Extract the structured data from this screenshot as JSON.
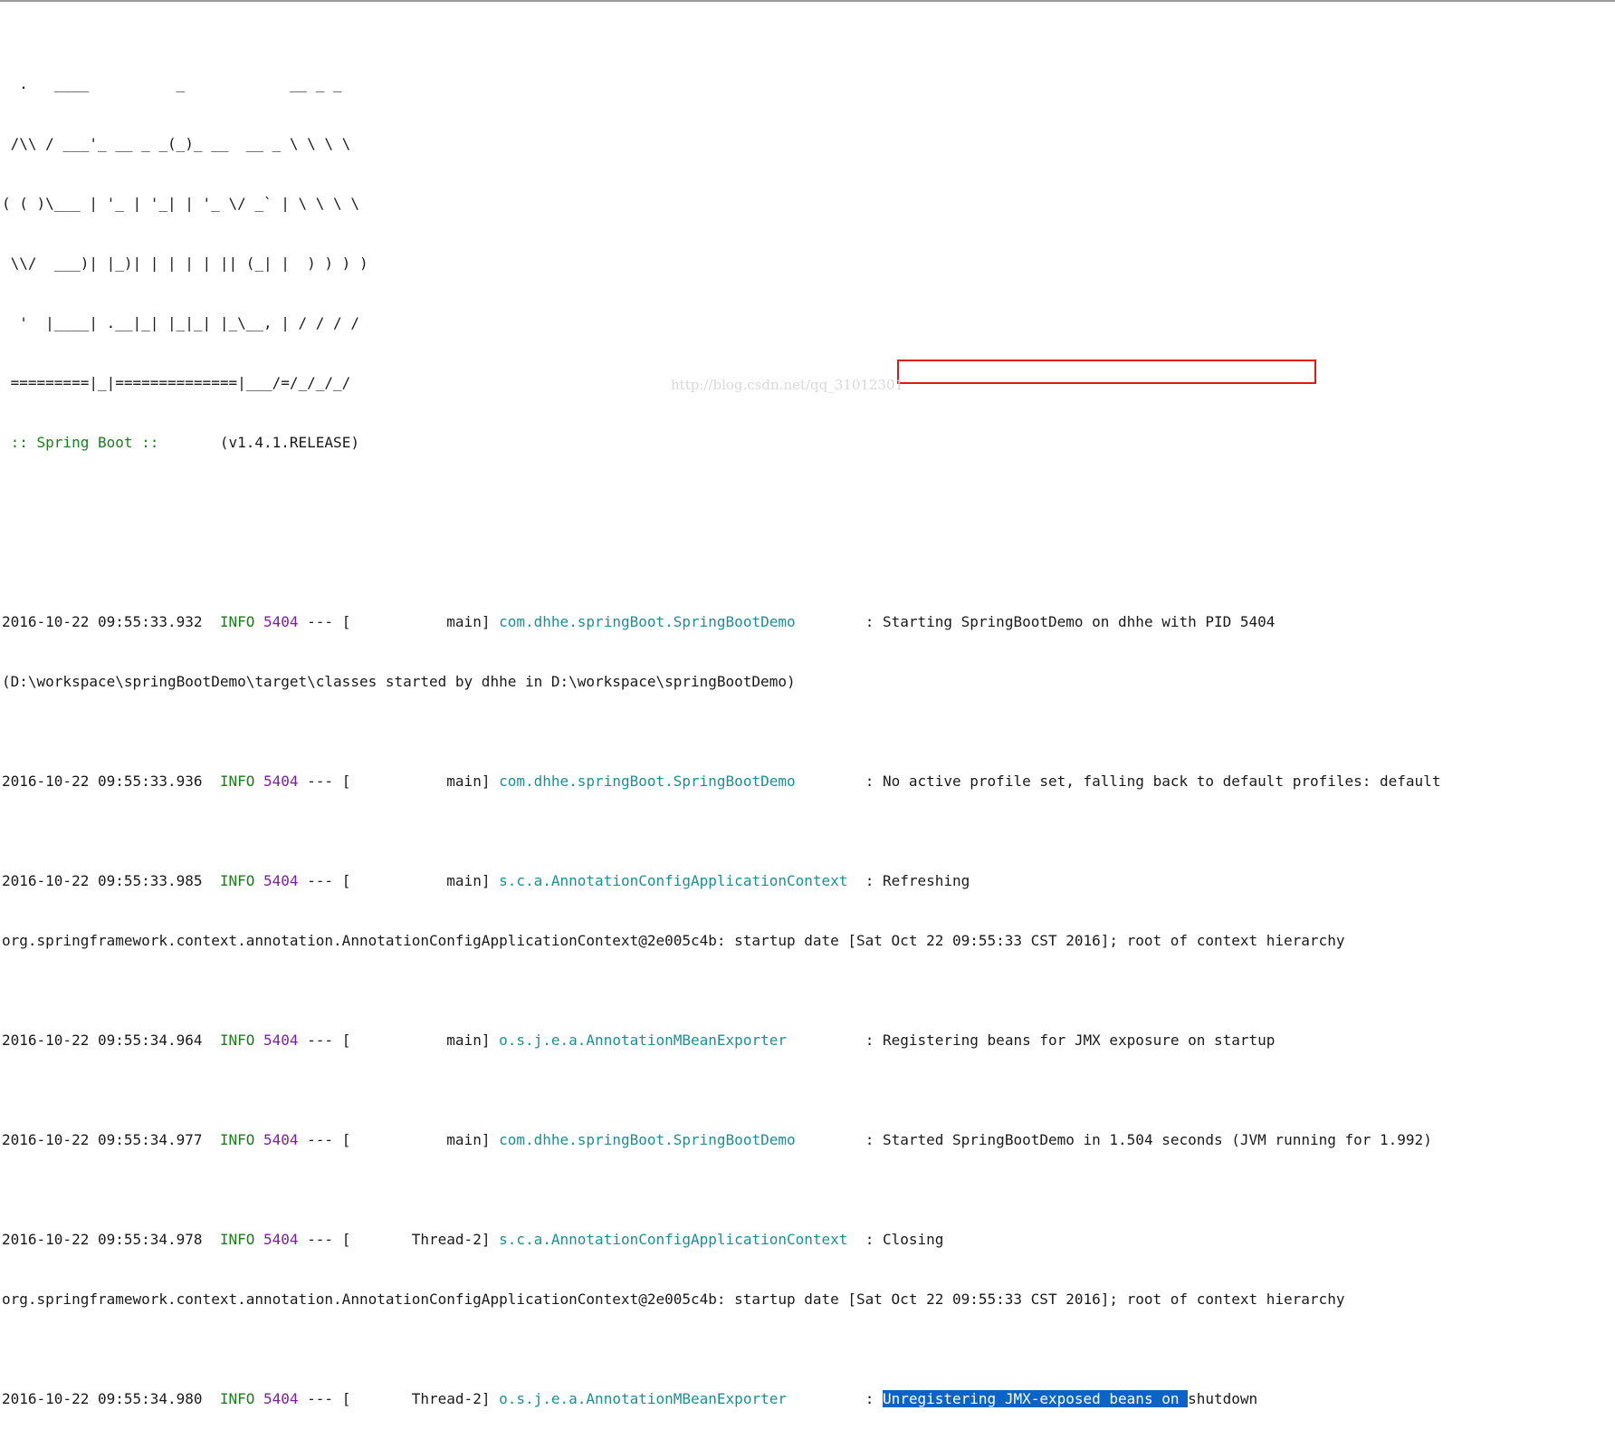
{
  "banner": {
    "lines": [
      "  .   ____          _            __ _ _",
      " /\\\\ / ___'_ __ _ _(_)_ __  __ _ \\ \\ \\ \\",
      "( ( )\\___ | '_ | '_| | '_ \\/ _` | \\ \\ \\ \\",
      " \\\\/  ___)| |_)| | | | | || (_| |  ) ) ) )",
      "  '  |____| .__|_| |_|_| |_\\__, | / / / /",
      " =========|_|==============|___/=/_/_/_/"
    ],
    "spring_tag": " :: Spring Boot :: ",
    "version": "      (v1.4.1.RELEASE)"
  },
  "log": [
    {
      "timestamp": "2016-10-22 09:55:33.932",
      "level": "INFO",
      "pid": "5404",
      "sep": " --- [",
      "thread": "           main]",
      "logger": "com.dhhe.springBoot.SpringBootDemo",
      "logger_pad": "       ",
      "message": ": Starting SpringBootDemo on dhhe with PID 5404",
      "continuation": "(D:\\workspace\\springBootDemo\\target\\classes started by dhhe in D:\\workspace\\springBootDemo)"
    },
    {
      "timestamp": "2016-10-22 09:55:33.936",
      "level": "INFO",
      "pid": "5404",
      "sep": " --- [",
      "thread": "           main]",
      "logger": "com.dhhe.springBoot.SpringBootDemo",
      "logger_pad": "       ",
      "message": ": No active profile set, falling back to default profiles: default"
    },
    {
      "timestamp": "2016-10-22 09:55:33.985",
      "level": "INFO",
      "pid": "5404",
      "sep": " --- [",
      "thread": "           main]",
      "logger": "s.c.a.AnnotationConfigApplicationContext",
      "logger_pad": " ",
      "message": ": Refreshing",
      "continuation": "org.springframework.context.annotation.AnnotationConfigApplicationContext@2e005c4b: startup date [Sat Oct 22 09:55:33 CST 2016]; root of context hierarchy"
    },
    {
      "timestamp": "2016-10-22 09:55:34.964",
      "level": "INFO",
      "pid": "5404",
      "sep": " --- [",
      "thread": "           main]",
      "logger": "o.s.j.e.a.AnnotationMBeanExporter",
      "logger_pad": "        ",
      "message": ": Registering beans for JMX exposure on startup"
    },
    {
      "timestamp": "2016-10-22 09:55:34.977",
      "level": "INFO",
      "pid": "5404",
      "sep": " --- [",
      "thread": "           main]",
      "logger": "com.dhhe.springBoot.SpringBootDemo",
      "logger_pad": "       ",
      "message": ": Started SpringBootDemo in 1.504 seconds (JVM running for 1.992)"
    },
    {
      "timestamp": "2016-10-22 09:55:34.978",
      "level": "INFO",
      "pid": "5404",
      "sep": " --- [",
      "thread": "       Thread-2]",
      "logger": "s.c.a.AnnotationConfigApplicationContext",
      "logger_pad": " ",
      "message": ": Closing",
      "continuation": "org.springframework.context.annotation.AnnotationConfigApplicationContext@2e005c4b: startup date [Sat Oct 22 09:55:33 CST 2016]; root of context hierarchy"
    },
    {
      "timestamp": "2016-10-22 09:55:34.980",
      "level": "INFO",
      "pid": "5404",
      "sep": " --- [",
      "thread": "       Thread-2]",
      "logger": "o.s.j.e.a.AnnotationMBeanExporter",
      "logger_pad": "        ",
      "message_prefix": ": ",
      "message_selected": "Unregistering JMX-exposed beans on ",
      "message_rest": "shutdown"
    }
  ],
  "watermark": "http://blog.csdn.net/qq_31012301",
  "colors": {
    "info": "#1a7f1a",
    "pid": "#7a1fa2",
    "logger": "#1a8f96",
    "selection": "#0a64c8",
    "highlight_box": "#e01818"
  }
}
